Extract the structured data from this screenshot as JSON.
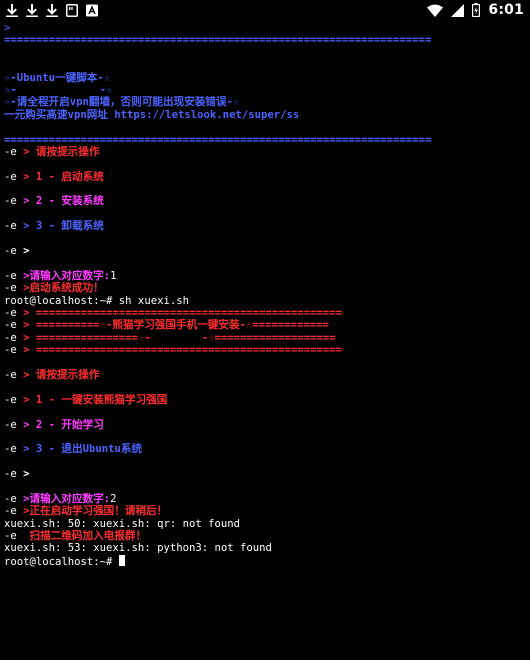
{
  "status_bar": {
    "time": "6:01",
    "left_icons": [
      "download-icon",
      "download-icon",
      "download-icon",
      "sd-card-icon",
      "text-input-icon"
    ],
    "right_icons": [
      "wifi-icon",
      "cell-signal-icon",
      "battery-charging-icon"
    ]
  },
  "terminal": {
    "colors": {
      "background": "#000000",
      "foreground": "#ffffff",
      "blue": "#4b63ff",
      "red": "#ff2d2d",
      "magenta": "#ff3bff"
    },
    "lines": [
      [
        {
          "t": ">",
          "c": "blue"
        }
      ],
      [
        {
          "t": "===================================================================",
          "c": "blue",
          "b": 1
        }
      ],
      [],
      [],
      [
        {
          "t": "☆-Ubuntu一键脚本-☆",
          "c": "blue",
          "b": 1
        }
      ],
      [
        {
          "t": "☆-             -☆",
          "c": "blue",
          "b": 1
        }
      ],
      [
        {
          "t": "☆-请全程开启vpn翻墙，否则可能出现安装错误-☆",
          "c": "blue",
          "b": 1
        }
      ],
      [
        {
          "t": "一元购买高速vpn网址 https://letslook.net/super/ss",
          "c": "blue",
          "b": 1
        }
      ],
      [],
      [
        {
          "t": "===================================================================",
          "c": "blue",
          "b": 1
        }
      ],
      [
        {
          "t": "-e ",
          "c": "white"
        },
        {
          "t": "> 请按提示操作",
          "c": "red",
          "b": 1
        }
      ],
      [],
      [
        {
          "t": "-e ",
          "c": "white"
        },
        {
          "t": "> 1 - 启动系统",
          "c": "red",
          "b": 1
        }
      ],
      [],
      [
        {
          "t": "-e ",
          "c": "white"
        },
        {
          "t": "> 2 - 安装系统",
          "c": "magenta",
          "b": 1
        }
      ],
      [],
      [
        {
          "t": "-e ",
          "c": "white"
        },
        {
          "t": "> 3 - 卸载系统",
          "c": "blue",
          "b": 1
        }
      ],
      [],
      [
        {
          "t": "-e ",
          "c": "white"
        },
        {
          "t": ">",
          "c": "white",
          "b": 1
        }
      ],
      [],
      [
        {
          "t": "-e ",
          "c": "white"
        },
        {
          "t": ">请输入对应数字:",
          "c": "magenta",
          "b": 1
        },
        {
          "t": "1",
          "c": "white"
        }
      ],
      [
        {
          "t": "-e ",
          "c": "white"
        },
        {
          "t": ">启动系统成功！",
          "c": "red",
          "b": 1
        }
      ],
      [
        {
          "t": "root@localhost:~# sh xuexi.sh",
          "c": "white"
        }
      ],
      [
        {
          "t": "-e ",
          "c": "white"
        },
        {
          "t": "> ================================================",
          "c": "red",
          "b": 1
        }
      ],
      [
        {
          "t": "-e ",
          "c": "white"
        },
        {
          "t": "> ==========☆-熊猫学习强国手机一键安装-☆============",
          "c": "red",
          "b": 1
        }
      ],
      [
        {
          "t": "-e ",
          "c": "white"
        },
        {
          "t": "> ================☆-        -☆===================",
          "c": "red",
          "b": 1
        }
      ],
      [
        {
          "t": "-e ",
          "c": "white"
        },
        {
          "t": "> ================================================",
          "c": "red",
          "b": 1
        }
      ],
      [],
      [
        {
          "t": "-e ",
          "c": "white"
        },
        {
          "t": "> 请按提示操作",
          "c": "red",
          "b": 1
        }
      ],
      [],
      [
        {
          "t": "-e ",
          "c": "white"
        },
        {
          "t": "> 1 - 一键安装熊猫学习强国",
          "c": "red",
          "b": 1
        }
      ],
      [],
      [
        {
          "t": "-e ",
          "c": "white"
        },
        {
          "t": "> 2 - 开始学习",
          "c": "magenta",
          "b": 1
        }
      ],
      [],
      [
        {
          "t": "-e ",
          "c": "white"
        },
        {
          "t": "> 3 - 退出Ubuntu系统",
          "c": "blue",
          "b": 1
        }
      ],
      [],
      [
        {
          "t": "-e ",
          "c": "white"
        },
        {
          "t": ">",
          "c": "white",
          "b": 1
        }
      ],
      [],
      [
        {
          "t": "-e ",
          "c": "white"
        },
        {
          "t": ">请输入对应数字:",
          "c": "magenta",
          "b": 1
        },
        {
          "t": "2",
          "c": "white"
        }
      ],
      [
        {
          "t": "-e ",
          "c": "white"
        },
        {
          "t": ">正在启动学习强国！请稍后！",
          "c": "red",
          "b": 1
        }
      ],
      [
        {
          "t": "xuexi.sh: 50: xuexi.sh: qr: not found",
          "c": "white"
        }
      ],
      [
        {
          "t": "-e ",
          "c": "white"
        },
        {
          "t": " 扫描二维码加入电报群！",
          "c": "red",
          "b": 1
        }
      ],
      [
        {
          "t": "xuexi.sh: 53: xuexi.sh: python3: not found",
          "c": "white"
        }
      ],
      [
        {
          "t": "root@localhost:~# ",
          "c": "white"
        },
        {
          "cursor": true
        }
      ]
    ]
  }
}
